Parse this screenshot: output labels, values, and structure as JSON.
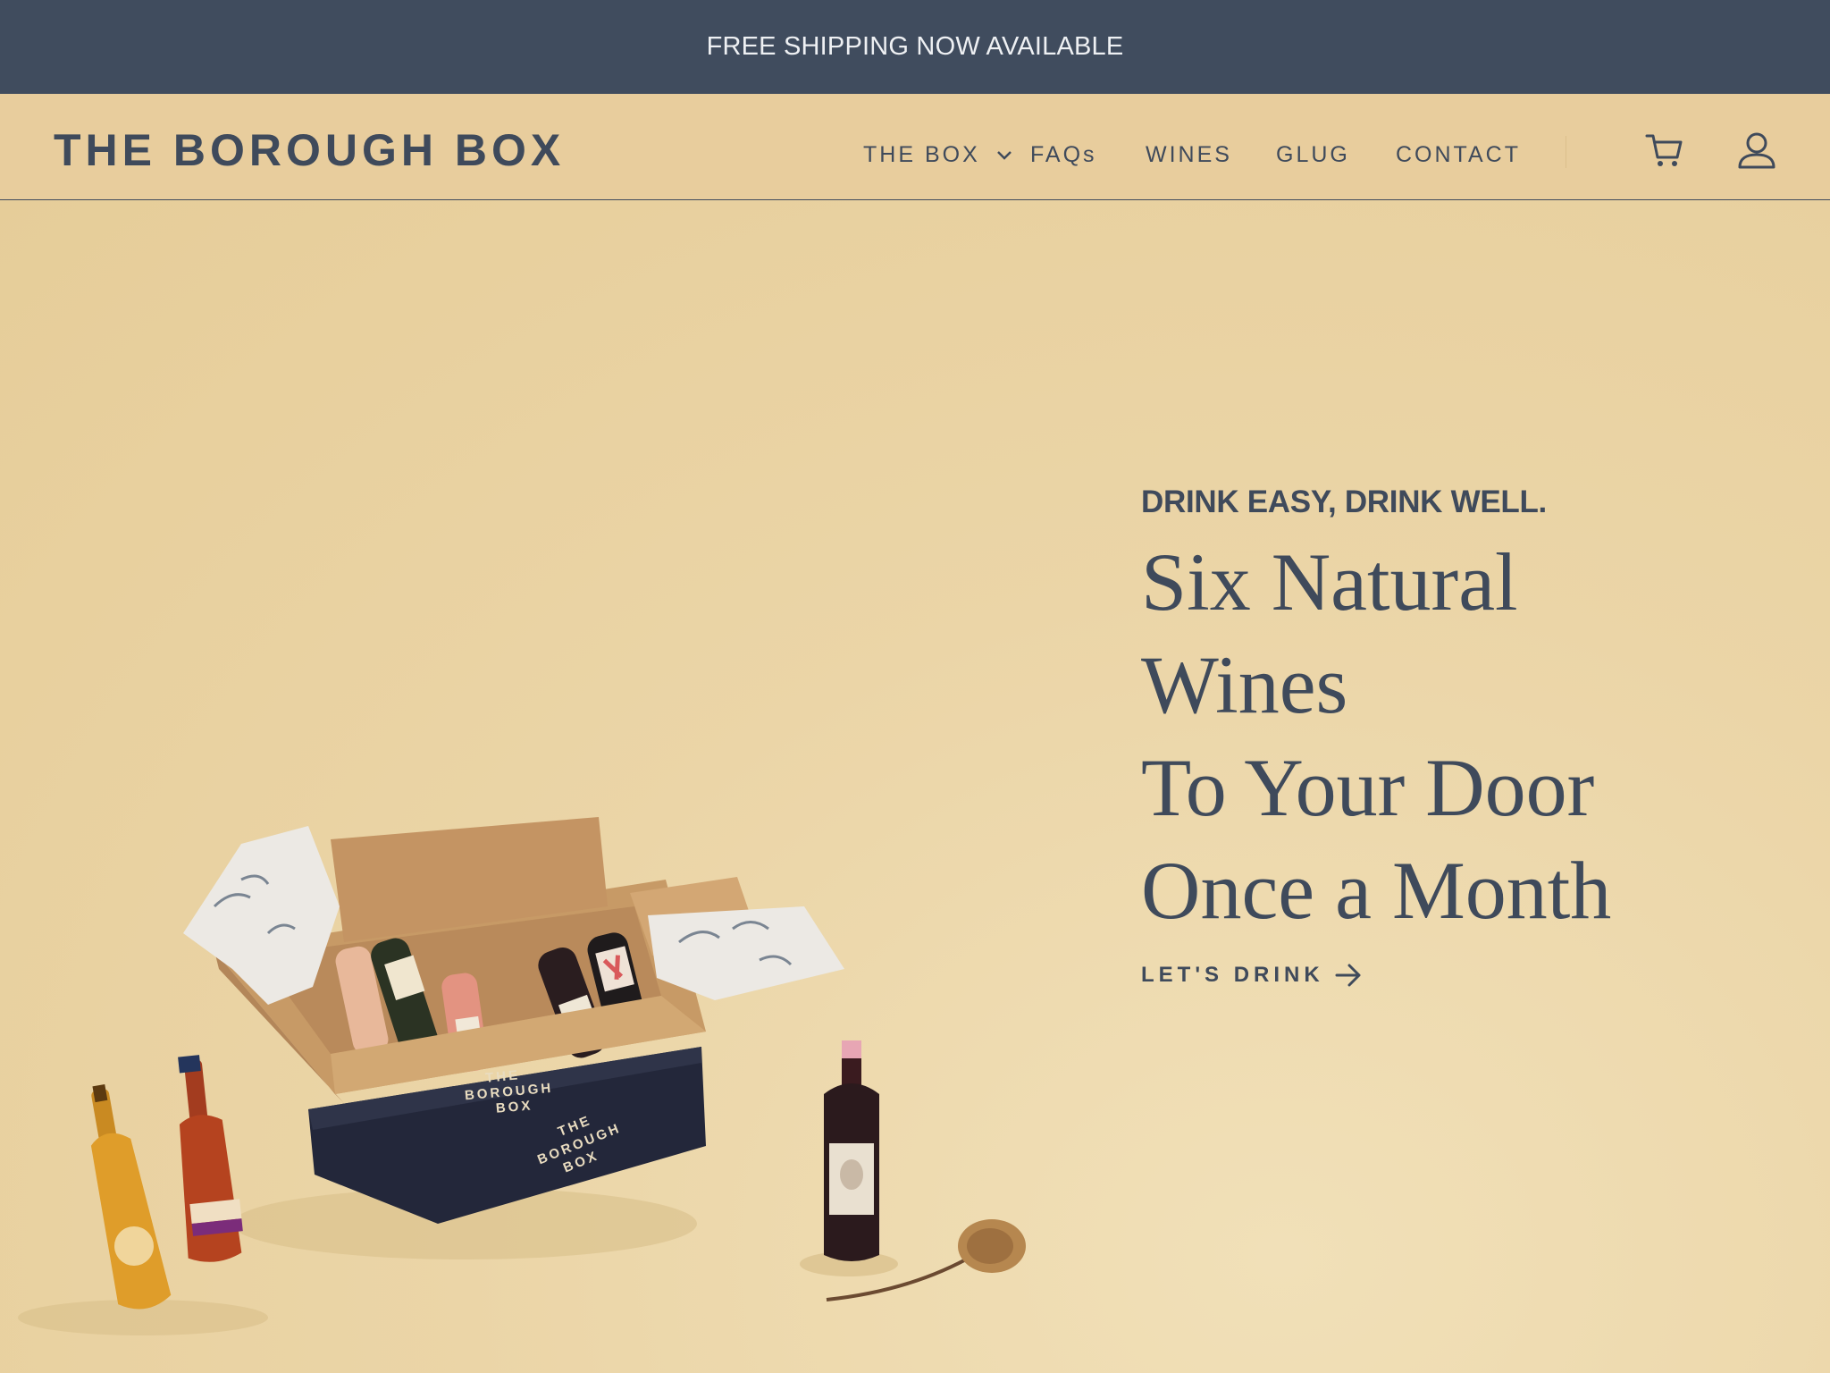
{
  "announcement": {
    "text": "FREE SHIPPING NOW AVAILABLE"
  },
  "header": {
    "logo": "THE BOROUGH BOX",
    "nav": {
      "the_box": "THE BOX",
      "faqs": "FAQs",
      "wines": "WINES",
      "glug": "GLUG",
      "contact": "CONTACT"
    },
    "icons": {
      "cart": "cart-icon",
      "account": "account-icon",
      "dropdown": "chevron-down-icon"
    }
  },
  "hero": {
    "kicker": "DRINK EASY, DRINK WELL.",
    "headline": [
      "Six Natural",
      "Wines",
      "To Your Door",
      "Once a Month"
    ],
    "cta": "LET'S DRINK",
    "cta_icon": "arrow-right-icon",
    "box_label": [
      "THE",
      "BOROUGH",
      "BOX"
    ]
  },
  "colors": {
    "primary": "#404c5e",
    "background": "#e9d3a2",
    "header_bg": "#e8cd9d"
  }
}
